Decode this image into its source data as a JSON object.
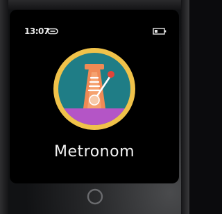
{
  "status_bar": {
    "time": "13:07",
    "link_icon": "link-icon",
    "battery_icon": "battery-icon"
  },
  "app": {
    "label": "Metronom",
    "icon": "metronome-icon"
  },
  "hardware": {
    "home_button_icon": "home-button-ring"
  },
  "colors": {
    "icon_ring": "#f0c24a",
    "icon_background": "#1f7d86",
    "icon_base": "#b455c6",
    "metronome_body": "#f08a55",
    "pendulum_arm": "#ffffff",
    "pendulum_tip": "#e0443a"
  }
}
